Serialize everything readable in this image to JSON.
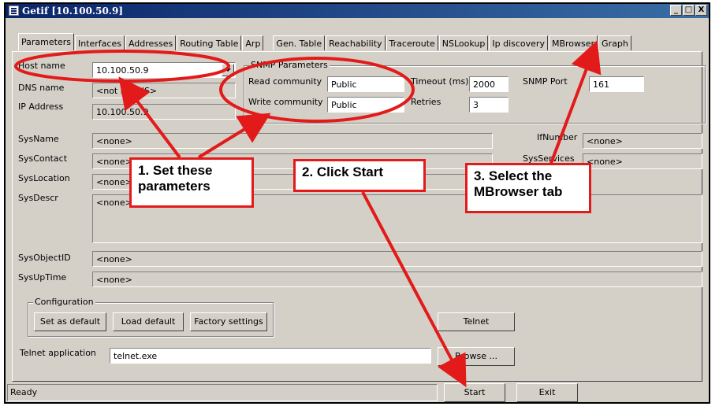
{
  "window": {
    "title": "Getif [10.100.50.9]",
    "buttons": [
      "_",
      "□",
      "X"
    ]
  },
  "tabs": [
    {
      "label": "Parameters",
      "active": true
    },
    {
      "label": "Interfaces"
    },
    {
      "label": "Addresses"
    },
    {
      "label": "Routing Table"
    },
    {
      "label": "Arp"
    },
    {
      "label": "Gen. Table"
    },
    {
      "label": "Reachability"
    },
    {
      "label": "Traceroute"
    },
    {
      "label": "NSLookup"
    },
    {
      "label": "Ip discovery"
    },
    {
      "label": "MBrowser"
    },
    {
      "label": "Graph"
    }
  ],
  "host": {
    "host_name_label": "Host name",
    "host_name_value": "10.100.50.9",
    "dns_name_label": "DNS name",
    "dns_name_value": "<not in DNS>",
    "ip_address_label": "IP Address",
    "ip_address_value": "10.100.50.9"
  },
  "snmp": {
    "group_title": "SNMP Parameters",
    "read_community_label": "Read community",
    "read_community_value": "Public",
    "write_community_label": "Write community",
    "write_community_value": "Public",
    "timeout_label": "Timeout (ms)",
    "timeout_value": "2000",
    "retries_label": "Retries",
    "retries_value": "3",
    "port_label": "SNMP Port",
    "port_value": "161"
  },
  "system": {
    "sysname_label": "SysName",
    "sysname_value": "<none>",
    "syscontact_label": "SysContact",
    "syscontact_value": "<none>",
    "syslocation_label": "SysLocation",
    "syslocation_value": "<none>",
    "sysdescr_label": "SysDescr",
    "sysdescr_value": "<none>",
    "sysobjectid_label": "SysObjectID",
    "sysobjectid_value": "<none>",
    "sysuptime_label": "SysUpTime",
    "sysuptime_value": "<none>",
    "ifnumber_label": "IfNumber",
    "ifnumber_value": "<none>",
    "sysservices_label": "SysServices",
    "sysservices_value": "<none>"
  },
  "configuration": {
    "group_title": "Configuration",
    "set_default_label": "Set as default",
    "load_default_label": "Load default",
    "factory_settings_label": "Factory settings",
    "telnet_button_label": "Telnet",
    "telnet_app_label": "Telnet application",
    "telnet_app_value": "telnet.exe",
    "browse_label": "Browse ..."
  },
  "footer": {
    "status_text": "Ready",
    "start_label": "Start",
    "exit_label": "Exit"
  },
  "annotations": {
    "callout1_line1": "1. Set these",
    "callout1_line2": "parameters",
    "callout2": "2. Click Start",
    "callout3_line1": "3. Select the",
    "callout3_line2": "MBrowser tab",
    "color": "#e31a1a"
  }
}
